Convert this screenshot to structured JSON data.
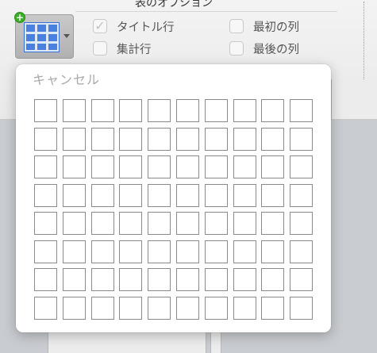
{
  "ribbon": {
    "group_title": "表のオプション",
    "table_button": {
      "icon": "table-grid-icon",
      "badge": "+",
      "dropdown_icon": "chevron-down-icon"
    },
    "options": [
      {
        "label": "タイトル行",
        "checked": true
      },
      {
        "label": "最初の列",
        "checked": false
      },
      {
        "label": "集計行",
        "checked": false
      },
      {
        "label": "最後の列",
        "checked": false
      }
    ],
    "check_glyph": "✓"
  },
  "popup": {
    "cancel_label": "キャンセル",
    "grid": {
      "rows": 8,
      "columns": 10
    }
  },
  "colors": {
    "badge_green": "#3fae2a",
    "table_icon_blue": "#3a6fd3",
    "cell_border": "#8a8a8a"
  }
}
